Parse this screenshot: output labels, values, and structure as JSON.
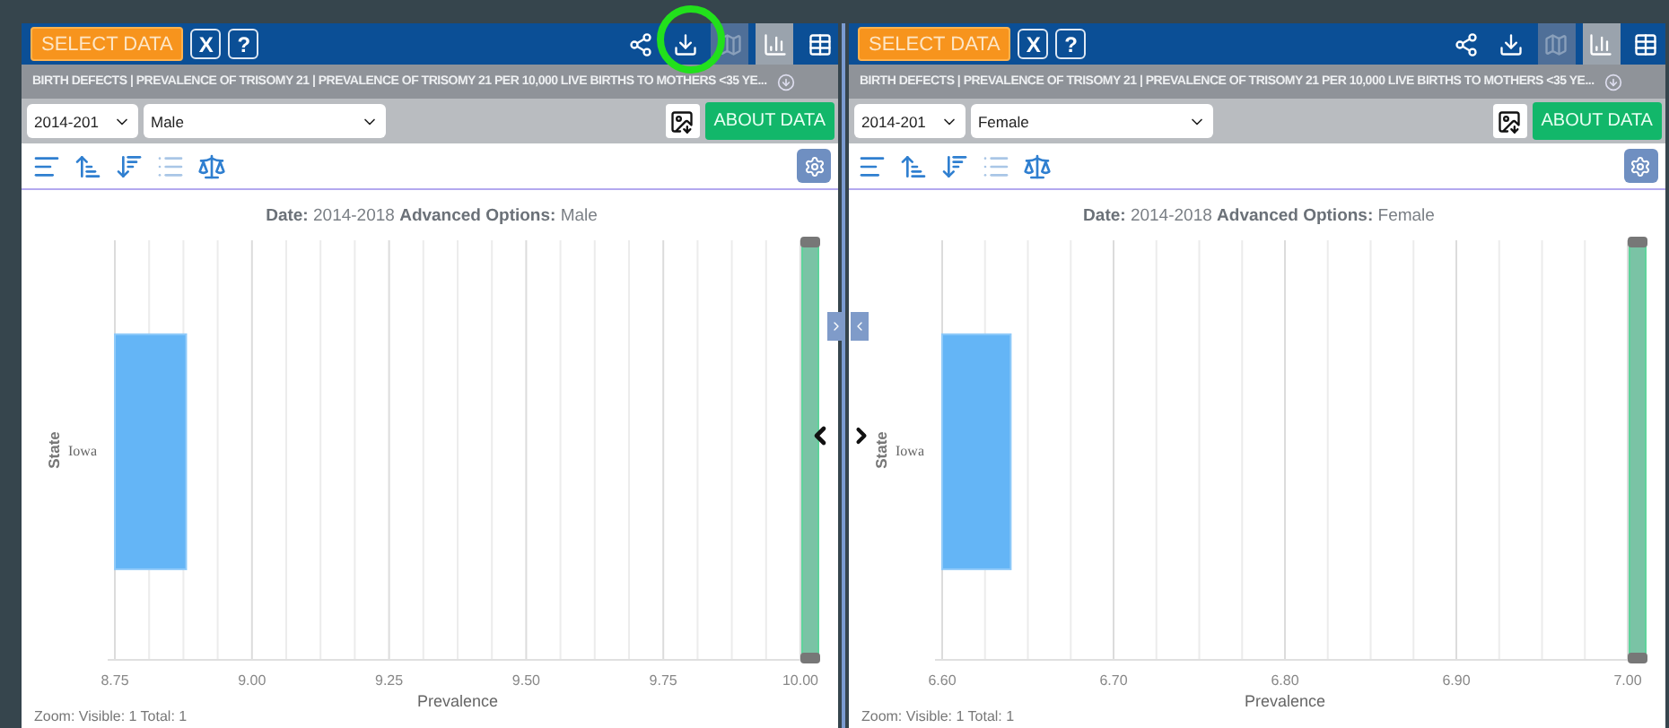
{
  "panels": [
    {
      "select_button": "SELECT DATA",
      "close_button": "X",
      "help_button": "?",
      "views": [
        {
          "kind": "map",
          "selected": false,
          "disabled": true
        },
        {
          "kind": "chart",
          "selected": true,
          "disabled": false
        },
        {
          "kind": "table",
          "selected": false,
          "disabled": false
        }
      ],
      "highlight_download": true,
      "subtitle": "BIRTH DEFECTS | PREVALENCE OF TRISOMY 21 | PREVALENCE OF TRISOMY 21 PER 10,000 LIVE BIRTHS TO MOTHERS <35 YE...",
      "year_select": "2014-201",
      "option_select": "Male",
      "about_button": "ABOUT DATA",
      "tools": [
        {
          "kind": "bars",
          "disabled": false
        },
        {
          "kind": "sort-up",
          "disabled": false
        },
        {
          "kind": "sort-down",
          "disabled": false
        },
        {
          "kind": "list",
          "disabled": true
        },
        {
          "kind": "scale",
          "disabled": false
        }
      ],
      "title_parts": [
        {
          "label": "Date:",
          "value": "2014-2018"
        },
        {
          "label": "Advanced Options:",
          "value": "Male"
        }
      ],
      "chart_data": {
        "type": "bar",
        "orientation": "horizontal",
        "grid": true,
        "xlabel": "Prevalence",
        "ylabel": "State",
        "categories": [
          "Iowa"
        ],
        "values": [
          8.88
        ],
        "xlim": [
          8.75,
          10.0
        ],
        "xticks": [
          {
            "value": 8.75,
            "label": "8.75"
          },
          {
            "value": 9.0,
            "label": "9.00"
          },
          {
            "value": 9.25,
            "label": "9.25"
          },
          {
            "value": 9.5,
            "label": "9.50"
          },
          {
            "value": 9.75,
            "label": "9.75"
          },
          {
            "value": 10.0,
            "label": "10.00"
          }
        ]
      },
      "zoom_text": "Zoom: Visible: 1 Total: 1"
    },
    {
      "select_button": "SELECT DATA",
      "close_button": "X",
      "help_button": "?",
      "views": [
        {
          "kind": "map",
          "selected": false,
          "disabled": true
        },
        {
          "kind": "chart",
          "selected": true,
          "disabled": false
        },
        {
          "kind": "table",
          "selected": false,
          "disabled": false
        }
      ],
      "highlight_download": false,
      "subtitle": "BIRTH DEFECTS | PREVALENCE OF TRISOMY 21 | PREVALENCE OF TRISOMY 21 PER 10,000 LIVE BIRTHS TO MOTHERS <35 YE...",
      "year_select": "2014-201",
      "option_select": "Female",
      "about_button": "ABOUT DATA",
      "tools": [
        {
          "kind": "bars",
          "disabled": false
        },
        {
          "kind": "sort-up",
          "disabled": false
        },
        {
          "kind": "sort-down",
          "disabled": false
        },
        {
          "kind": "list",
          "disabled": true
        },
        {
          "kind": "scale",
          "disabled": false
        }
      ],
      "title_parts": [
        {
          "label": "Date:",
          "value": "2014-2018"
        },
        {
          "label": "Advanced Options:",
          "value": "Female"
        }
      ],
      "chart_data": {
        "type": "bar",
        "orientation": "horizontal",
        "grid": true,
        "xlabel": "Prevalence",
        "ylabel": "State",
        "categories": [
          "Iowa"
        ],
        "values": [
          6.64
        ],
        "xlim": [
          6.6,
          7.0
        ],
        "xticks": [
          {
            "value": 6.6,
            "label": "6.60"
          },
          {
            "value": 6.7,
            "label": "6.70"
          },
          {
            "value": 6.8,
            "label": "6.80"
          },
          {
            "value": 6.9,
            "label": "6.90"
          },
          {
            "value": 7.0,
            "label": "7.00"
          }
        ]
      },
      "zoom_text": "Zoom: Visible: 1 Total: 1"
    }
  ]
}
